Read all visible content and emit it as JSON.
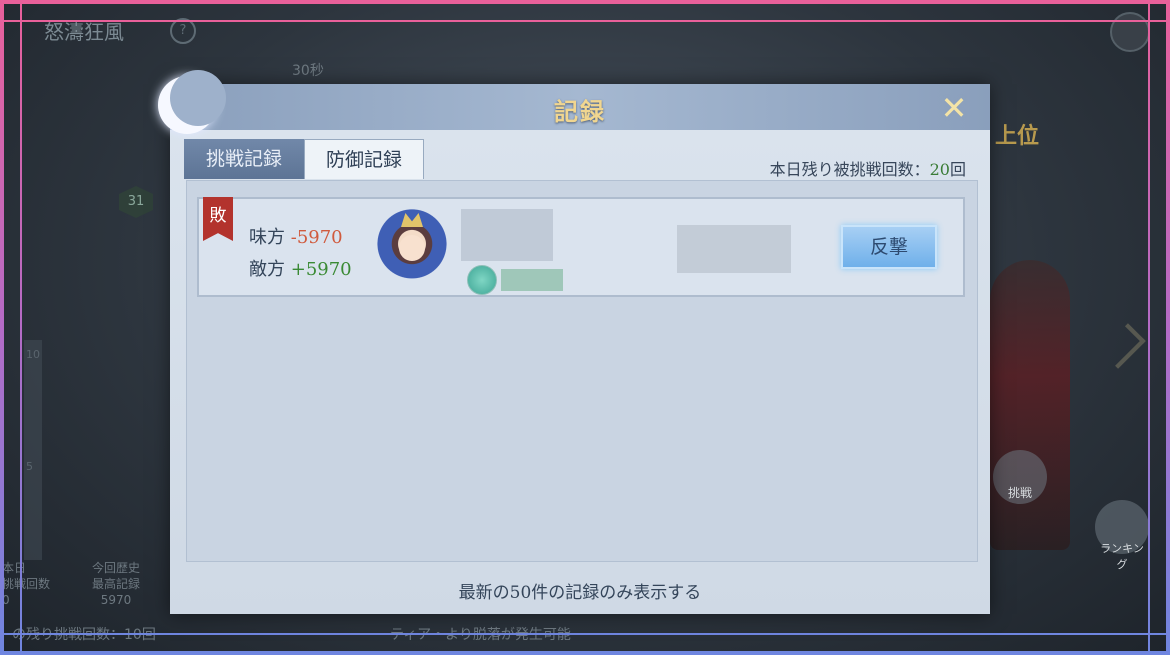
{
  "background": {
    "event_title": "怒濤狂風",
    "help_icon": "question-icon",
    "seconds_text": "30秒",
    "rank_label": "上位",
    "level_badge": "31",
    "side_numbers": [
      "10",
      "5"
    ],
    "challenge_label": "挑戦",
    "ranking_label": "ランキング",
    "bottom_left_lines": [
      "本日",
      "挑戦回数",
      "0"
    ],
    "bottom_mid_lines": [
      "今回歴史",
      "最高記録",
      "5970"
    ],
    "bottom_text_left": "の残り挑戦回数：10回",
    "bottom_text_mid": "ティア・より脱落が発生可能"
  },
  "dialog": {
    "title": "記録",
    "close_icon": "close-icon",
    "tabs": [
      {
        "label": "挑戦記録",
        "active": false
      },
      {
        "label": "防御記録",
        "active": true
      }
    ],
    "remaining_label": "本日残り被挑戦回数：",
    "remaining_count": "20",
    "remaining_unit": "回",
    "records": [
      {
        "result": "敗",
        "ally_label": "味方",
        "ally_score": "-5970",
        "enemy_label": "敵方",
        "enemy_score": "+5970",
        "counter_label": "反撃"
      }
    ],
    "footer": "最新の50件の記録のみ表示する"
  },
  "colors": {
    "frame_top": "#e9609a",
    "frame_bottom": "#6f86e0",
    "title_gold": "#f1d690",
    "lose_red": "#b3332d",
    "negative": "#d05a3d",
    "positive": "#3a8a34"
  }
}
